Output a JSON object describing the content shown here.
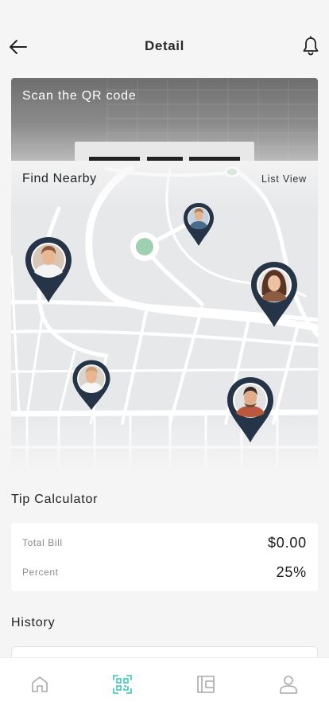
{
  "header": {
    "title": "Detail",
    "back_icon": "arrow-left-icon",
    "bell_icon": "bell-icon"
  },
  "qr_card": {
    "title": "Scan the QR code"
  },
  "map": {
    "title": "Find Nearby",
    "list_view_label": "List View",
    "pin_color": "#253447",
    "park_color": "#9fd0b0",
    "road_color": "#ffffff",
    "pins": [
      {
        "name": "pin-user-1",
        "icon": "avatar-icon"
      },
      {
        "name": "pin-user-2",
        "icon": "avatar-icon"
      },
      {
        "name": "pin-user-3",
        "icon": "avatar-icon"
      },
      {
        "name": "pin-user-4",
        "icon": "avatar-icon"
      },
      {
        "name": "pin-user-5",
        "icon": "avatar-icon"
      }
    ]
  },
  "tip_calculator": {
    "title": "Tip Calculator",
    "total_bill_label": "Total Bill",
    "total_bill_value": "$0.00",
    "percent_label": "Percent",
    "percent_value": "25%"
  },
  "history": {
    "title": "History"
  },
  "tab_bar": {
    "active_color": "#3cc6c0",
    "inactive_color": "#a9a9a9",
    "tabs": [
      {
        "icon": "home-icon",
        "active": false
      },
      {
        "icon": "qr-scan-icon",
        "active": true
      },
      {
        "icon": "wallet-icon",
        "active": false
      },
      {
        "icon": "user-icon",
        "active": false
      }
    ]
  }
}
